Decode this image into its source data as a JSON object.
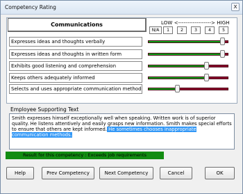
{
  "window": {
    "title": "Competency Rating",
    "close_label": "x"
  },
  "panel": {
    "heading": "Communications",
    "scale": {
      "low": "LOW",
      "arrow": "<------------------>",
      "high": "HIGH",
      "buttons": [
        "N/A",
        "1",
        "2",
        "3",
        "4",
        "5"
      ]
    },
    "rows": [
      {
        "label": "Expresses ideas and thoughts verbally",
        "rating_fraction": 0.92
      },
      {
        "label": "Expresses ideas and thoughts in written form",
        "rating_fraction": 0.92
      },
      {
        "label": "Exhibits good listening and comprehension",
        "rating_fraction": 0.72
      },
      {
        "label": "Keeps others adequately informed",
        "rating_fraction": 0.72
      },
      {
        "label": "Selects and uses appropriate communication methods",
        "rating_fraction": 0.36
      }
    ]
  },
  "comments": {
    "label": "Employee Supporting Text",
    "text": "Smith expresses himself exceptionally well when speaking. Written work is of superior quality. He listens attentively and easily grasps new information. Smith makes special efforts to ensure that others are kept informed.",
    "selected_text": " He sometimes chooses inappropriate communication methods."
  },
  "result": {
    "text": "Result for this competency : Exceeds job requirements"
  },
  "footer": {
    "help": "Help",
    "prev": "Prev Competency",
    "next": "Next Competency",
    "cancel": "Cancel",
    "ok": "OK"
  },
  "colors": {
    "positive": "#10a21a",
    "negative": "#8b0b2d",
    "result": "#128c12"
  }
}
